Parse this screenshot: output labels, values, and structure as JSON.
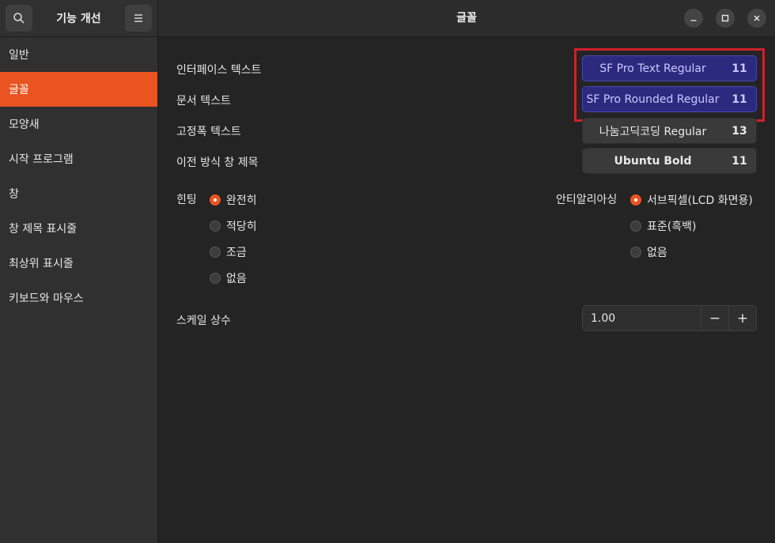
{
  "sidebar": {
    "title": "기능 개선",
    "search_icon": "search-icon",
    "menu_icon": "hamburger-menu-icon",
    "items": [
      {
        "label": "일반"
      },
      {
        "label": "글꼴"
      },
      {
        "label": "모양새"
      },
      {
        "label": "시작 프로그램"
      },
      {
        "label": "창"
      },
      {
        "label": "창 제목 표시줄"
      },
      {
        "label": "최상위 표시줄"
      },
      {
        "label": "키보드와 마우스"
      }
    ],
    "active_index": 1
  },
  "header": {
    "title": "글꼴",
    "controls": [
      "minimize-icon",
      "maximize-icon",
      "close-icon"
    ]
  },
  "fonts": {
    "interface": {
      "label": "인터페이스 텍스트",
      "name": "SF Pro Text Regular",
      "size": "11"
    },
    "document": {
      "label": "문서 텍스트",
      "name": "SF Pro Rounded Regular",
      "size": "11"
    },
    "monospace": {
      "label": "고정폭 텍스트",
      "name": "나눔고딕코딩 Regular",
      "size": "13"
    },
    "titlebar": {
      "label": "이전 방식 창 제목",
      "name": "Ubuntu Bold",
      "size": "11"
    }
  },
  "hinting": {
    "label": "힌팅",
    "options": [
      "완전히",
      "적당히",
      "조금",
      "없음"
    ],
    "selected": "완전히"
  },
  "antialiasing": {
    "label": "안티알리아싱",
    "options": [
      "서브픽셀(LCD 화면용)",
      "표준(흑백)",
      "없음"
    ],
    "selected": "서브픽셀(LCD 화면용)"
  },
  "scale": {
    "label": "스케일 상수",
    "value": "1.00",
    "minus": "−",
    "plus": "+"
  },
  "colors": {
    "accent": "#e95420",
    "highlight_border": "#d0202a",
    "highlight_fill": "#2b2a7e"
  }
}
